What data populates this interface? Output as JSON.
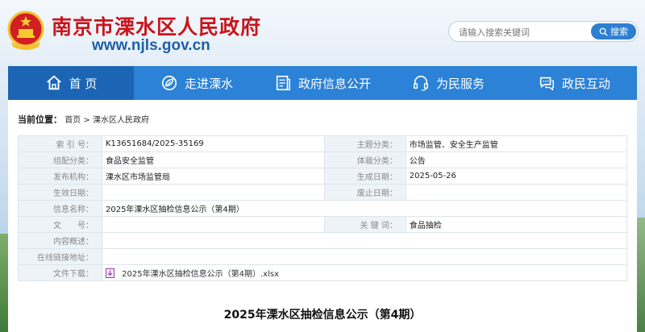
{
  "header": {
    "site_title": "南京市溧水区人民政府",
    "site_url": "www.njls.gov.cn",
    "search_placeholder": "请输入搜索关键词",
    "search_button": "搜索"
  },
  "nav": {
    "items": [
      {
        "label": "首 页",
        "icon": "home-icon",
        "active": true
      },
      {
        "label": "走进溧水",
        "icon": "leaf-icon",
        "active": false
      },
      {
        "label": "政府信息公开",
        "icon": "document-icon",
        "active": false
      },
      {
        "label": "为民服务",
        "icon": "headset-icon",
        "active": false
      },
      {
        "label": "政民互动",
        "icon": "chat-icon",
        "active": false
      }
    ]
  },
  "breadcrumb": {
    "label": "当前位置：",
    "home": "首页",
    "separator": ">",
    "current": "溧水区人民政府"
  },
  "meta": {
    "index_no_label": "索 引 号：",
    "index_no": "K13651684/2025-35169",
    "topic_label": "主题分类：",
    "topic": "市场监管、安全生产监管",
    "org_category_label": "组配分类：",
    "org_category": "食品安全监管",
    "genre_label": "体裁分类：",
    "genre": "公告",
    "publisher_label": "发布机构：",
    "publisher": "溧水区市场监管局",
    "created_label": "生成日期：",
    "created": "2025-05-26",
    "effective_label": "生效日期：",
    "effective": "",
    "repeal_label": "废止日期：",
    "repeal": "",
    "info_name_label": "信息名称：",
    "info_name": "2025年溧水区抽检信息公示（第4期）",
    "doc_no_label": "文　　号：",
    "doc_no": "",
    "keywords_label": "关 键 词：",
    "keywords": "食品抽检",
    "summary_label": "内容概述：",
    "summary": "",
    "online_link_label": "在线链接地址：",
    "online_link": "",
    "download_label": "文件下载：",
    "download_file": "2025年溧水区抽检信息公示（第4期）.xlsx"
  },
  "document": {
    "title": "2025年溧水区抽检信息公示（第4期）"
  },
  "colors": {
    "title_red": "#c8151d",
    "url_blue": "#1e5fa6",
    "nav_blue": "#2b82d6",
    "nav_active": "#1c65b4",
    "label_bg": "#eef3f8"
  }
}
